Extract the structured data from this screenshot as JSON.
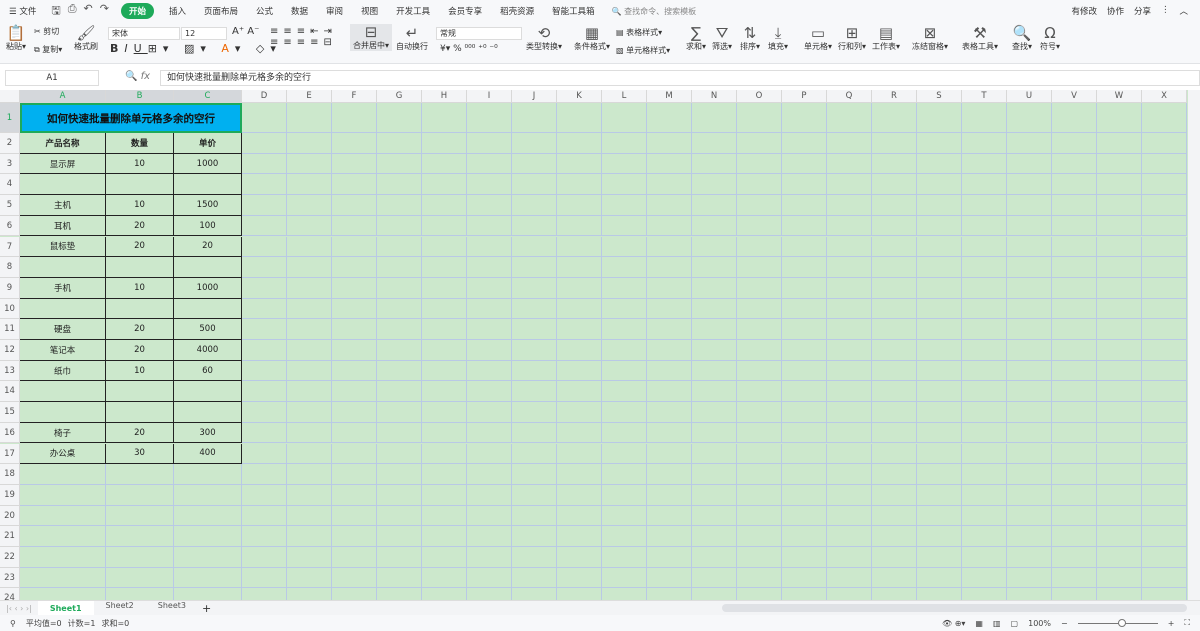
{
  "menu": {
    "file": "文件",
    "tabs": [
      "开始",
      "插入",
      "页面布局",
      "公式",
      "数据",
      "审阅",
      "视图",
      "开发工具",
      "会员专享",
      "稻壳资源",
      "智能工具箱"
    ],
    "active_tab": "开始",
    "search_placeholder": "查找命令、搜索模板",
    "right": [
      "有修改",
      "协作",
      "分享"
    ]
  },
  "ribbon": {
    "paste": "粘贴",
    "cut": "剪切",
    "copy": "复制",
    "format_painter": "格式刷",
    "font": "宋体",
    "font_size": "12",
    "merge": "合并居中",
    "wrap": "自动换行",
    "number_format": "常规",
    "convert": "类型转换",
    "cond_format": "条件格式",
    "table_style": "表格样式",
    "cell_style": "单元格样式",
    "sum": "求和",
    "filter": "筛选",
    "sort": "排序",
    "fill": "填充",
    "cell": "单元格",
    "rowcol": "行和列",
    "sheet": "工作表",
    "freeze": "冻结窗格",
    "tools": "表格工具",
    "find": "查找",
    "symbol": "符号"
  },
  "formula": {
    "name_box": "A1",
    "fx": "fx",
    "content": "如何快速批量删除单元格多余的空行"
  },
  "columns": [
    "A",
    "B",
    "C",
    "D",
    "E",
    "F",
    "G",
    "H",
    "I",
    "J",
    "K",
    "L",
    "M",
    "N",
    "O",
    "P",
    "Q",
    "R",
    "S",
    "T",
    "U",
    "V",
    "W",
    "X"
  ],
  "rows": [
    "1",
    "2",
    "3",
    "4",
    "5",
    "6",
    "7",
    "8",
    "9",
    "10",
    "11",
    "12",
    "13",
    "14",
    "15",
    "16",
    "17",
    "18",
    "19",
    "20",
    "21",
    "22",
    "23",
    "24"
  ],
  "table": {
    "title": "如何快速批量删除单元格多余的空行",
    "headers": [
      "产品名称",
      "数量",
      "单价"
    ],
    "data": [
      [
        "显示屏",
        "10",
        "1000"
      ],
      [
        "",
        "",
        ""
      ],
      [
        "主机",
        "10",
        "1500"
      ],
      [
        "耳机",
        "20",
        "100"
      ],
      [
        "鼠标垫",
        "20",
        "20"
      ],
      [
        "",
        "",
        ""
      ],
      [
        "手机",
        "10",
        "1000"
      ],
      [
        "",
        "",
        ""
      ],
      [
        "硬盘",
        "20",
        "500"
      ],
      [
        "笔记本",
        "20",
        "4000"
      ],
      [
        "纸巾",
        "10",
        "60"
      ],
      [
        "",
        "",
        ""
      ],
      [
        "",
        "",
        ""
      ],
      [
        "椅子",
        "20",
        "300"
      ],
      [
        "办公桌",
        "30",
        "400"
      ]
    ]
  },
  "sheets": [
    "Sheet1",
    "Sheet2",
    "Sheet3"
  ],
  "active_sheet": "Sheet1",
  "status": {
    "avg": "平均值=0",
    "count": "计数=1",
    "sum": "求和=0",
    "zoom": "100%"
  },
  "colors": {
    "accent": "#1eaa5a",
    "title_fill": "#00b0f0",
    "grid_bg": "#cce8cc"
  }
}
